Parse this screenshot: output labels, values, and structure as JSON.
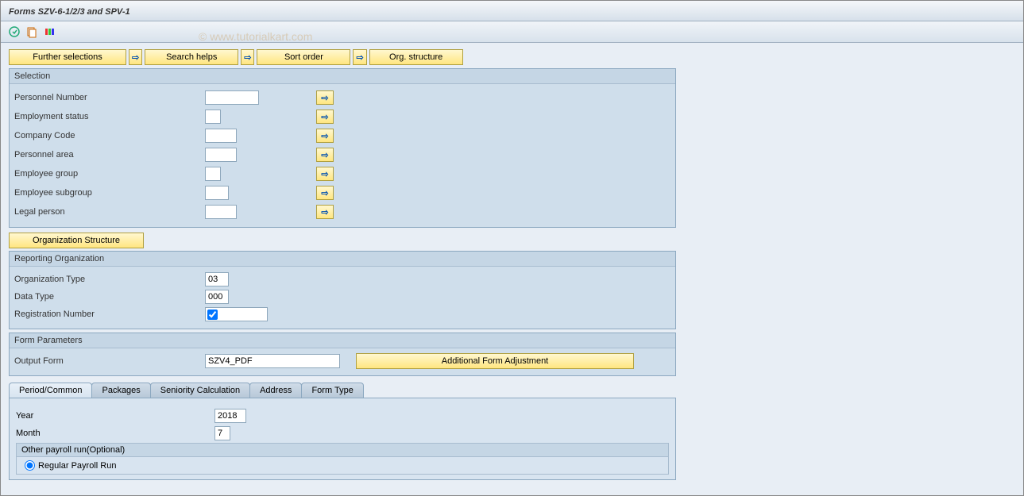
{
  "page_title": "Forms SZV-6-1/2/3 and SPV-1",
  "watermark": "© www.tutorialkart.com",
  "toolbar_buttons": {
    "further_selections": "Further selections",
    "search_helps": "Search helps",
    "sort_order": "Sort order",
    "org_structure": "Org. structure"
  },
  "selection": {
    "title": "Selection",
    "fields": {
      "personnel_number": "Personnel Number",
      "employment_status": "Employment status",
      "company_code": "Company Code",
      "personnel_area": "Personnel area",
      "employee_group": "Employee group",
      "employee_subgroup": "Employee subgroup",
      "legal_person": "Legal person"
    }
  },
  "org_structure_btn": "Organization Structure",
  "reporting_org": {
    "title": "Reporting Organization",
    "org_type_label": "Organization Type",
    "org_type_value": "03",
    "data_type_label": "Data Type",
    "data_type_value": "000",
    "reg_number_label": "Registration Number",
    "reg_number_value": ""
  },
  "form_params": {
    "title": "Form Parameters",
    "output_form_label": "Output Form",
    "output_form_value": "SZV4_PDF",
    "additional_btn": "Additional Form Adjustment"
  },
  "tabs": {
    "period_common": "Period/Common",
    "packages": "Packages",
    "seniority": "Seniority Calculation",
    "address": "Address",
    "form_type": "Form Type"
  },
  "period_tab": {
    "year_label": "Year",
    "year_value": "2018",
    "month_label": "Month",
    "month_value": "7",
    "other_payroll_title": "Other payroll run(Optional)",
    "regular_payroll_label": "Regular Payroll Run"
  }
}
